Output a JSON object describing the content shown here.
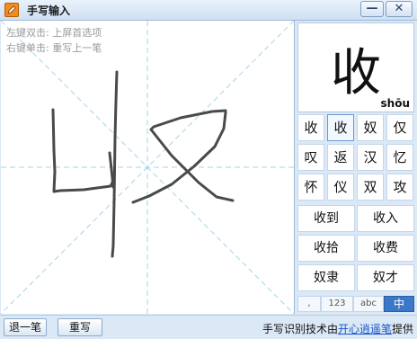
{
  "window": {
    "title": "手写输入",
    "minimize": "—",
    "close": "✕"
  },
  "canvas": {
    "hint_line1": "左键双击: 上屏首选项",
    "hint_line2": "右键单击: 重写上一笔",
    "guide_color": "#a9d3e4",
    "ink_color": "#4a4a4a"
  },
  "preview": {
    "char": "收",
    "pinyin": "shōu"
  },
  "candidates": [
    "收",
    "收",
    "奴",
    "仅",
    "叹",
    "返",
    "汉",
    "忆",
    "怀",
    "仪",
    "双",
    "攻"
  ],
  "selected_index": 1,
  "words": [
    "收到",
    "收入",
    "收拾",
    "收费",
    "奴隶",
    "奴才"
  ],
  "modes": [
    ",",
    "123",
    "abc",
    "中"
  ],
  "active_mode": 3,
  "status": {
    "undo_label": "退一笔",
    "rewrite_label": "重写",
    "credit_prefix": "手写识别技术由",
    "credit_link": "开心逍遥笔",
    "credit_suffix": "提供"
  }
}
